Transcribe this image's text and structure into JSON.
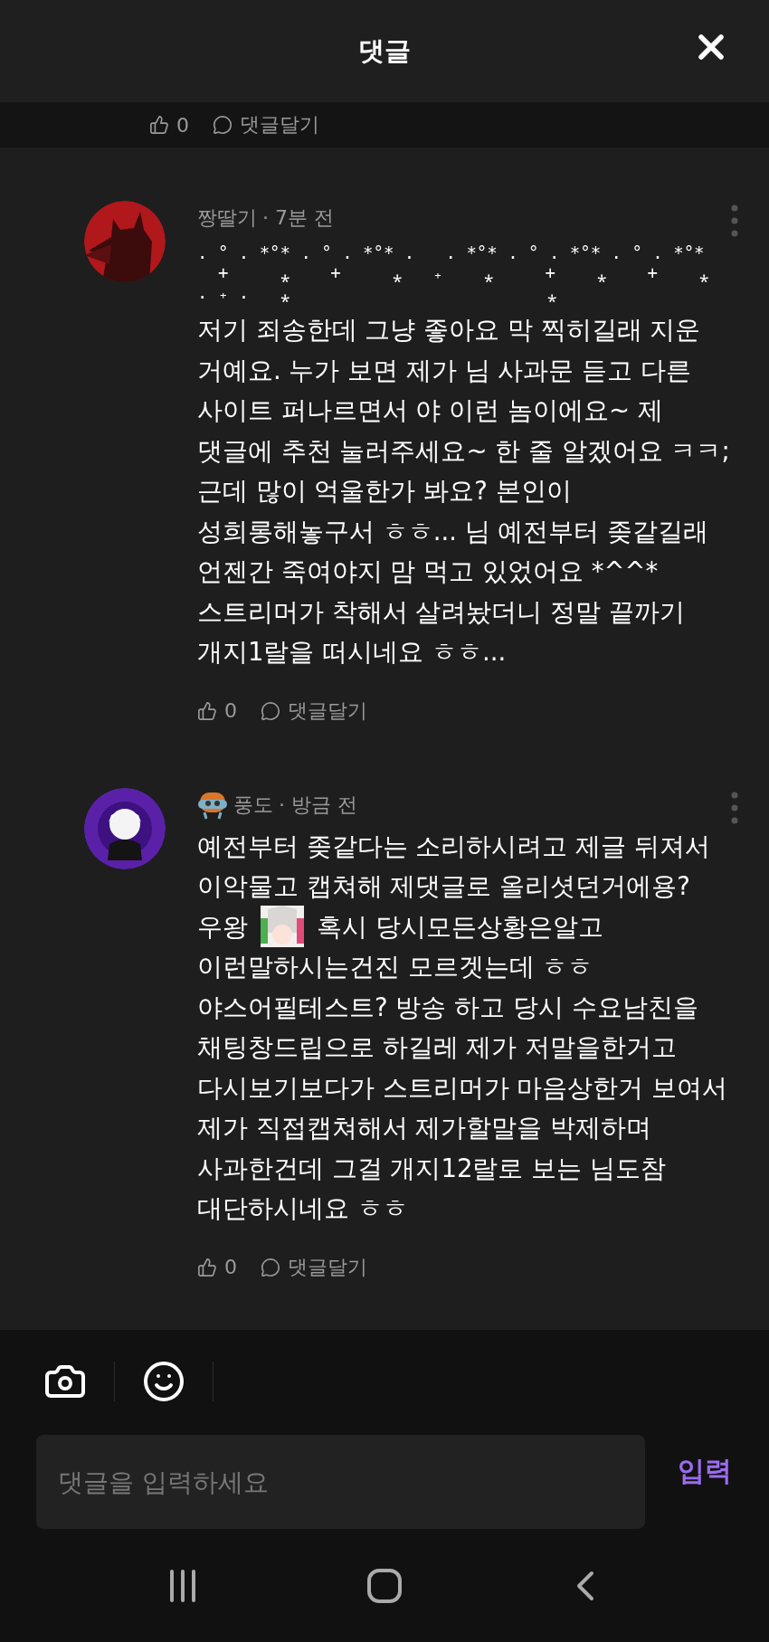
{
  "header": {
    "title": "댓글"
  },
  "previous_actions": {
    "likes": "0",
    "reply": "댓글달기"
  },
  "comments": [
    {
      "avatar": {
        "kind": "picture"
      },
      "badge": false,
      "name": "짱딸기",
      "time": "· 7분 전",
      "art_lines": [
        ". ° . *°* . ° . *°* .   . *°* . ° . *°* . ° . *°*",
        "  +     ⁎    +     ⁎   ₊    ⁎     +    ⁎    +    ⁎",
        ". ₊ .   ⁎                         ⁎"
      ],
      "body": [
        {
          "kind": "text",
          "text": "저기 죄송한데 그냥 좋아요 막 찍히길래 지운\n거예요. 누가 보면 제가 님 사과문 듣고 다른\n사이트 퍼나르면서 야 이런 놈이에요~ 제\n댓글에 추천 눌러주세요~ 한 줄 알겠어요 ㅋㅋ;\n근데 많이 억울한가 봐요? 본인이\n성희롱해놓구서 ㅎㅎ... 님 예전부터 좆같길래\n언젠간 죽여야지 맘 먹고 있었어요 *^^*\n스트리머가 착해서 살려놨더니 정말 끝까기\n개지1랄을 떠시네요 ㅎㅎ..."
        }
      ],
      "likes": "0",
      "reply": "댓글달기"
    },
    {
      "avatar": {
        "kind": "picture"
      },
      "badge": true,
      "name": "풍도",
      "time": "· 방금 전",
      "body": [
        {
          "kind": "text",
          "text": "예전부터 좆같다는 소리하시려고 제글 뒤져서\n이악물고 캡쳐해 제댓글로 올리셧던거에용?"
        },
        {
          "kind": "inline",
          "parts": [
            {
              "kind": "text",
              "text": "우왕"
            },
            {
              "kind": "picture"
            },
            {
              "kind": "text",
              "text": "혹시 당시모든상황은알고"
            }
          ]
        },
        {
          "kind": "text",
          "text": "이런말하시는건진 모르겟는데 ㅎㅎ\n야스어필테스트? 방송 하고 당시 수요남친을\n채팅창드립으로 하길레 제가 저말을한거고\n다시보기보다가 스트리머가 마음상한거 보여서\n제가 직접캡쳐해서 제가할말을 박제하며\n사과한건데 그걸 개지12랄로 보는 님도참\n대단하시네요 ㅎㅎ"
        }
      ],
      "likes": "0",
      "reply": "댓글달기"
    }
  ],
  "composer": {
    "placeholder": "댓글을 입력하세요",
    "submit": "입력"
  }
}
